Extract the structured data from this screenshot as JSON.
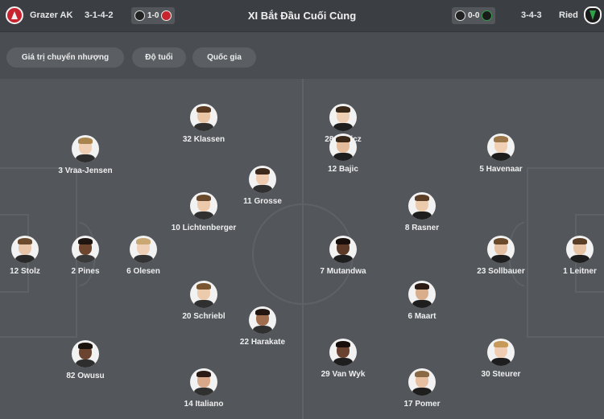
{
  "header": {
    "title": "XI Bắt Đầu Cuối Cùng",
    "home": {
      "name": "Grazer AK",
      "formation": "3-1-4-2",
      "last_score": "1-0"
    },
    "away": {
      "name": "Ried",
      "formation": "3-4-3",
      "last_score": "0-0"
    }
  },
  "filters": [
    "Giá trị chuyển nhượng",
    "Độ tuổi",
    "Quốc gia"
  ],
  "home_players": [
    {
      "label": "12 Stolz",
      "skin": "#e8c4a8",
      "hair": "#6b4a2e",
      "shirt": "#2a2a2a"
    },
    {
      "label": "2 Pines",
      "skin": "#6e4630",
      "hair": "#1e1410",
      "shirt": "#3a3a3a"
    },
    {
      "label": "6 Olesen",
      "skin": "#efd0b6",
      "hair": "#c9a874",
      "shirt": "#333333"
    },
    {
      "label": "3 Vraa-Jensen",
      "skin": "#efcfb4",
      "hair": "#a8844e",
      "shirt": "#2e2e2e"
    },
    {
      "label": "32 Klassen",
      "skin": "#e9c6a6",
      "hair": "#5a3b22",
      "shirt": "#303030"
    },
    {
      "label": "10 Lichtenberger",
      "skin": "#ecc9aa",
      "hair": "#6a4a2c",
      "shirt": "#303030"
    },
    {
      "label": "20 Schriebl",
      "skin": "#eccaac",
      "hair": "#7a5630",
      "shirt": "#303030"
    },
    {
      "label": "82 Owusu",
      "skin": "#6a4430",
      "hair": "#1a120e",
      "shirt": "#2e2e2e"
    },
    {
      "label": "11 Grosse",
      "skin": "#efccb0",
      "hair": "#3e2a1c",
      "shirt": "#303030"
    },
    {
      "label": "22 Harakate",
      "skin": "#a06e4e",
      "hair": "#231610",
      "shirt": "#303030"
    },
    {
      "label": "14 Italiano",
      "skin": "#d9a888",
      "hair": "#2a1c14",
      "shirt": "#303030"
    }
  ],
  "away_players": [
    {
      "label": "28 Bajlicz",
      "skin": "#efcfb4",
      "hair": "#3a2818",
      "shirt": "#1e1e1e"
    },
    {
      "label": "12 Bajic",
      "skin": "#e4bc9c",
      "hair": "#3a2818",
      "shirt": "#1e1e1e"
    },
    {
      "label": "8 Rasner",
      "skin": "#eccaac",
      "hair": "#5a3e26",
      "shirt": "#1e1e1e"
    },
    {
      "label": "7 Mutandwa",
      "skin": "#5c3a28",
      "hair": "#180f0a",
      "shirt": "#1e1e1e"
    },
    {
      "label": "6 Maart",
      "skin": "#d8ae8c",
      "hair": "#2a1c14",
      "shirt": "#1e1e1e"
    },
    {
      "label": "29 Van Wyk",
      "skin": "#6a4230",
      "hair": "#180f0a",
      "shirt": "#1e1e1e"
    },
    {
      "label": "17 Pomer",
      "skin": "#e6c0a0",
      "hair": "#8a6a44",
      "shirt": "#1e1e1e"
    },
    {
      "label": "5 Havenaar",
      "skin": "#f0d0b4",
      "hair": "#9a7648",
      "shirt": "#1e1e1e"
    },
    {
      "label": "23 Sollbauer",
      "skin": "#e6c0a2",
      "hair": "#6a4a2a",
      "shirt": "#1e1e1e"
    },
    {
      "label": "30 Steurer",
      "skin": "#f0cdb2",
      "hair": "#c79a5a",
      "shirt": "#1e1e1e"
    },
    {
      "label": "1 Leitner",
      "skin": "#e8c4a6",
      "hair": "#5a3e26",
      "shirt": "#1e1e1e"
    }
  ],
  "colors": {
    "pitch": "#53575c",
    "lines": "#5e6267",
    "header": "#3b3f44",
    "pill": "#5b5f64"
  }
}
